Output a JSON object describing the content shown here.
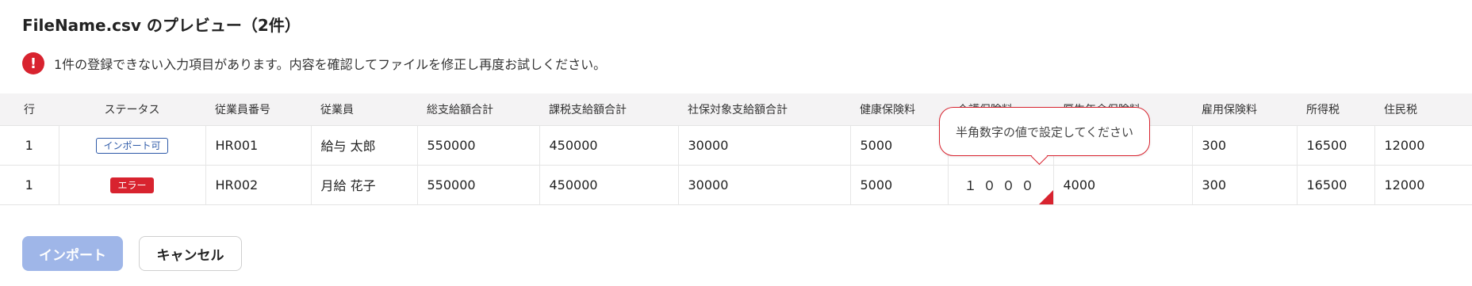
{
  "title": "FileName.csv のプレビュー（2件）",
  "alert": {
    "icon": "!",
    "message": "1件の登録できない入力項目があります。内容を確認してファイルを修正し再度お試しください。"
  },
  "table": {
    "headers": [
      "行",
      "ステータス",
      "従業員番号",
      "従業員",
      "総支給額合計",
      "課税支給額合計",
      "社保対象支給額合計",
      "健康保険料",
      "介護保険料",
      "厚生年金保険料",
      "雇用保険料",
      "所得税",
      "住民税"
    ],
    "rows": [
      [
        "1",
        "インポート可",
        "HR001",
        "給与 太郎",
        "550000",
        "450000",
        "30000",
        "5000",
        "",
        "",
        "300",
        "16500",
        "12000"
      ],
      [
        "1",
        "エラー",
        "HR002",
        "月給 花子",
        "550000",
        "450000",
        "30000",
        "5000",
        "１０００",
        "4000",
        "300",
        "16500",
        "12000"
      ]
    ]
  },
  "tooltip": "半角数字の値で設定してください",
  "buttons": {
    "import": "インポート",
    "cancel": "キャンセル"
  },
  "colors": {
    "error": "#d8232f",
    "ok_badge": "#2e5aa8",
    "import_disabled": "#9fb6e8"
  }
}
